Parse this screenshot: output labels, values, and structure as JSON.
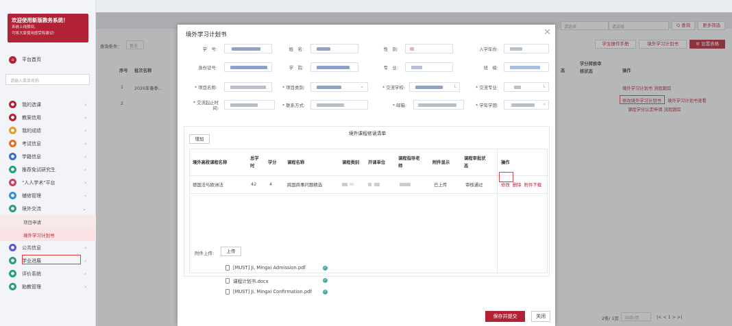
{
  "sidebar": {
    "welcome_title": "欢迎使用新版教务系统！",
    "welcome_line1": "系统上线期间,",
    "welcome_line2": "可将大家使用感受和建议!",
    "home": "平台首页",
    "search_placeholder": "请输入菜单名称",
    "items": [
      {
        "label": "我的选课",
        "color": "#b22236"
      },
      {
        "label": "教案信用",
        "color": "#b22236"
      },
      {
        "label": "我的成绩",
        "color": "#e0a020"
      },
      {
        "label": "考试信息",
        "color": "#e07020"
      },
      {
        "label": "学籍信息",
        "color": "#3a6fc9"
      },
      {
        "label": "推荐免试研究生",
        "color": "#2aa07a"
      },
      {
        "label": "\"人人学术\"平台",
        "color": "#d04060"
      },
      {
        "label": "辅修管理",
        "color": "#3a8fd0"
      },
      {
        "label": "境外交流",
        "color": "#2aa07a"
      }
    ],
    "sub_items": [
      "项目申请",
      "境外学习计划书"
    ],
    "bottom_items": [
      {
        "label": "公共信息",
        "color": "#5a5ad0"
      },
      {
        "label": "学业进展",
        "color": "#2aa07a"
      },
      {
        "label": "评价系统",
        "color": "#2aa07a"
      },
      {
        "label": "助教管理",
        "color": "#2aa07a"
      }
    ]
  },
  "background": {
    "query_label": "查询条件：",
    "query_value": "暂无",
    "select1": "请选择",
    "select2": "请选择",
    "search_btn": "Q 查询",
    "more_btn": "更多筛选",
    "manual_btn": "学生操作手册",
    "plan_btn": "境外学习计划书",
    "settings_btn": "⚙ 设置表格",
    "col_no": "序号",
    "col_batch": "批次名称",
    "col_state": "态",
    "col_credit": "学分转换审核状态",
    "col_op": "操作",
    "row1_no": "1",
    "row1_batch": "2026年春季...",
    "row2_no": "2",
    "row1_op": "境外学习计划书  流程跟踪",
    "row2_op1": "修改境外学习计划书",
    "row2_op2": "境外学习计划书查看",
    "row2_op3": "课程学分认定申请  流程跟踪",
    "pagination": "2条/ 1页",
    "page_size": "30条/页",
    "page_nav": "|< < 1 > >|"
  },
  "dialog": {
    "title": "境外学习计划书",
    "labels": {
      "student_no": "学　号:",
      "name": "姓　名:",
      "gender": "性　别:",
      "enroll_year": "入学年份:",
      "id_no": "身份证号:",
      "college": "学　院:",
      "major": "专　业:",
      "class": "班　级:",
      "project_name": "* 项目名称:",
      "project_type": "* 项目类别:",
      "exchange_school": "* 交流学校:",
      "exchange_major": "* 交流专业:",
      "exchange_time_1": "* 交流起止时",
      "exchange_time_2": "间:",
      "contact": "* 联系方式:",
      "email": "* 邮箱:",
      "term": "* 学年学期:"
    },
    "course_list_title": "境外课程修读清单",
    "add_btn": "增加",
    "table": {
      "headers": [
        "境外高校课程名称",
        "总学时",
        "学分",
        "课程名称",
        "课程类别",
        "开课单位",
        "课程指导老师",
        "附件显示",
        "课程审批状态",
        "操作"
      ],
      "row": {
        "foreign_course": "德国法与欧洲法",
        "hours": "42",
        "credits": "4",
        "course_name": "跨国商事问题精选",
        "attachment": "已上传",
        "status": "审核通过",
        "op_edit": "修改",
        "op_delete": "删除",
        "op_download": "附件下载"
      }
    },
    "attachment_label": "附件上传:",
    "upload_btn": "上传",
    "files": [
      "[MUST] Ji, Mingxi Admission.pdf",
      "课程计划书.docx",
      "[MUST] Ji, Mingxi Confirmation.pdf"
    ],
    "save_btn": "保存并提交",
    "close_btn": "关闭"
  },
  "colors": {
    "accent": "#b22236",
    "highlight": "#e13b3b"
  }
}
